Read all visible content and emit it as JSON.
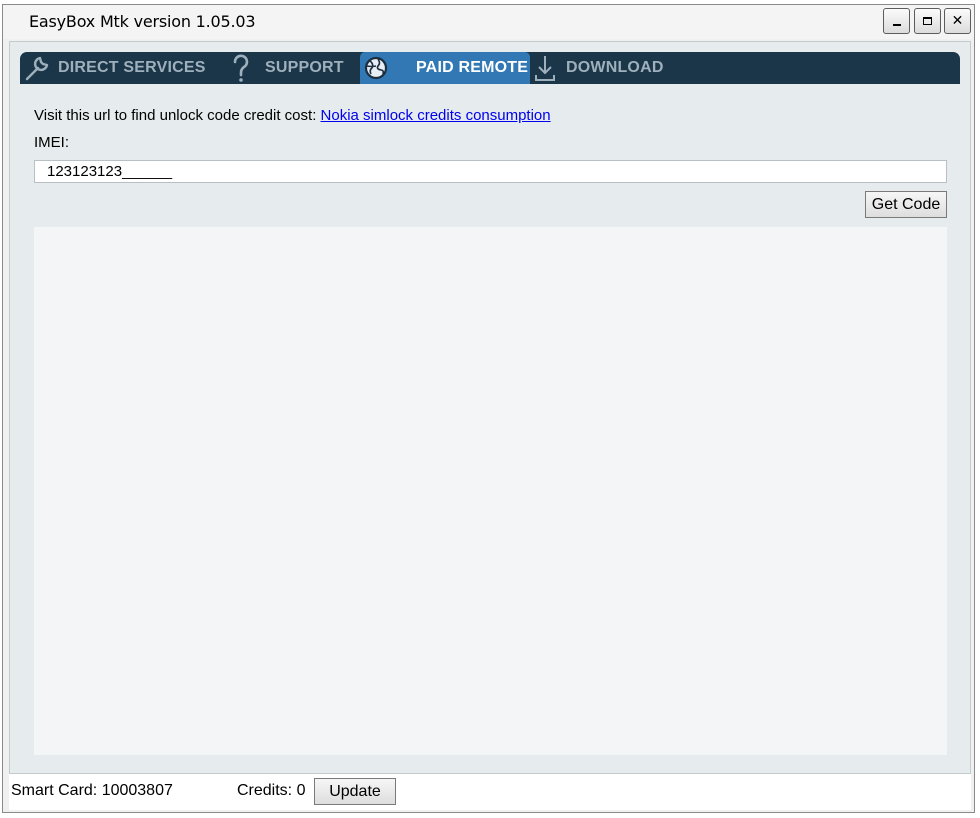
{
  "window": {
    "title": "EasyBox Mtk version 1.05.03",
    "controls": {
      "minimize": "minimize",
      "maximize": "maximize",
      "close": "close"
    }
  },
  "tabs": [
    {
      "label": "DIRECT SERVICES",
      "icon": "wrench-icon",
      "active": false
    },
    {
      "label": "SUPPORT",
      "icon": "question-icon",
      "active": false
    },
    {
      "label": "PAID REMOTE",
      "icon": "globe-icon",
      "active": true
    },
    {
      "label": "DOWNLOAD",
      "icon": "download-icon",
      "active": false
    }
  ],
  "paid_remote": {
    "info_text": "Visit this url to find unlock code credit cost: ",
    "info_link": "Nokia simlock credits consumption",
    "imei_label": "IMEI:",
    "imei_value": "123123123______",
    "get_code_label": "Get Code",
    "output_text": ""
  },
  "status": {
    "smart_card": "Smart Card: 10003807",
    "credits": "Credits: 0",
    "update_label": "Update"
  },
  "colors": {
    "tabbar_bg": "#1b3648",
    "tab_active_bg": "#3178b5",
    "tab_inactive_text": "#9fb0bd",
    "panel_bg": "#e6eced",
    "link": "#0000ee"
  }
}
